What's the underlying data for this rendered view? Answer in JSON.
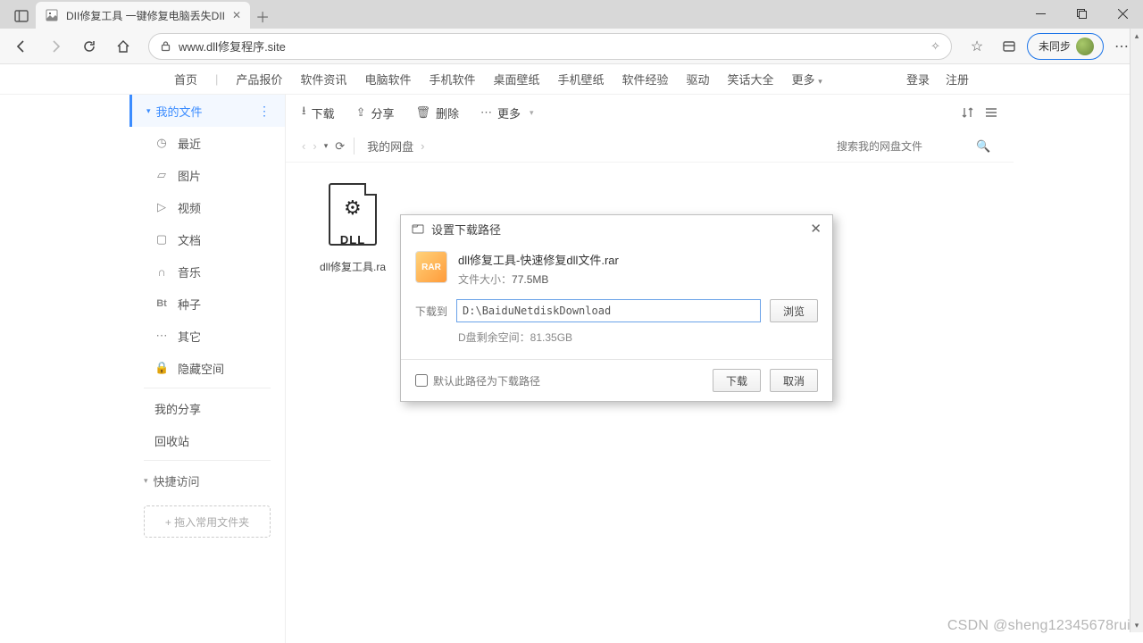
{
  "browser": {
    "tab_title": "DII修复工具 一键修复电脑丢失DII",
    "url": "www.dll修复程序.site",
    "profile_label": "未同步"
  },
  "site_nav": {
    "items": [
      "首页",
      "产品报价",
      "软件资讯",
      "电脑软件",
      "手机软件",
      "桌面壁纸",
      "手机壁纸",
      "软件经验",
      "驱动",
      "笑话大全",
      "更多"
    ],
    "login": "登录",
    "register": "注册"
  },
  "sidebar": {
    "my_files": "我的文件",
    "items": [
      {
        "icon": "◷",
        "label": "最近"
      },
      {
        "icon": "▱",
        "label": "图片"
      },
      {
        "icon": "▷",
        "label": "视频"
      },
      {
        "icon": "▢",
        "label": "文档"
      },
      {
        "icon": "∩",
        "label": "音乐"
      },
      {
        "icon": "Bt",
        "label": "种子"
      },
      {
        "icon": "⋯",
        "label": "其它"
      },
      {
        "icon": "🔒",
        "label": "隐藏空间"
      }
    ],
    "my_share": "我的分享",
    "recycle": "回收站",
    "quick_access": "快捷访问",
    "drop_hint": "+ 拖入常用文件夹"
  },
  "toolbar": {
    "download": "下载",
    "share": "分享",
    "delete": "删除",
    "more": "更多"
  },
  "breadcrumb": {
    "root": "我的网盘",
    "search_placeholder": "搜索我的网盘文件"
  },
  "file": {
    "name": "dll修复工具.ra",
    "badge": "DLL"
  },
  "dialog": {
    "title": "设置下载路径",
    "file_name": "dll修复工具-快速修复dll文件.rar",
    "size_label": "文件大小：",
    "size_value": "77.5MB",
    "dest_label": "下载到",
    "dest_value": "D:\\BaiduNetdiskDownload",
    "browse": "浏览",
    "free_space": "D盘剩余空间：81.35GB",
    "default_path": "默认此路径为下载路径",
    "ok": "下载",
    "cancel": "取消"
  },
  "watermark": "CSDN @sheng12345678rui"
}
